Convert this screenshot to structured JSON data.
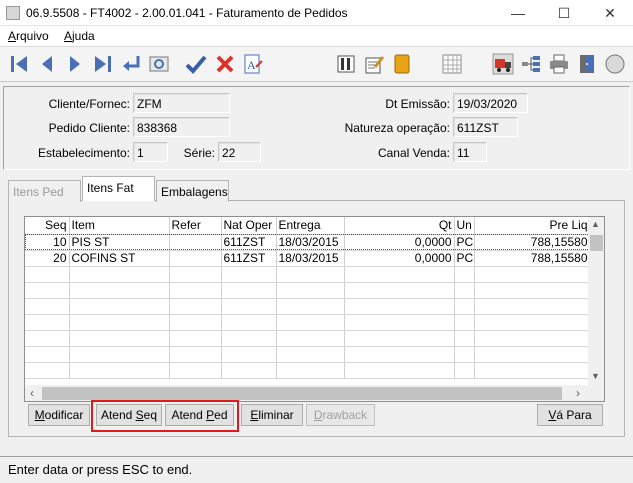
{
  "window": {
    "title": "06.9.5508 - FT4002 - 2.00.01.041 - Faturamento de Pedidos"
  },
  "menu": [
    {
      "label": "Arquivo"
    },
    {
      "label": "Ajuda"
    }
  ],
  "header": {
    "cliente_label": "Cliente/Fornec:",
    "cliente_value": "ZFM",
    "pedido_label": "Pedido Cliente:",
    "pedido_value": "838368",
    "estab_label": "Estabelecimento:",
    "estab_value": "1",
    "serie_label": "Série:",
    "serie_value": "22",
    "dt_emissao_label": "Dt Emissão:",
    "dt_emissao_value": "19/03/2020",
    "natureza_label": "Natureza operação:",
    "natureza_value": "611ZST",
    "canal_label": "Canal Venda:",
    "canal_value": "11"
  },
  "tabs": [
    {
      "label": "Itens Ped",
      "active": false,
      "disabled": true
    },
    {
      "label": "Itens Fat",
      "active": true,
      "disabled": false
    },
    {
      "label": "Embalagens",
      "active": false,
      "disabled": false
    }
  ],
  "grid": {
    "columns": [
      "Seq",
      "Item",
      "Refer",
      "Nat Oper",
      "Entrega",
      "Qt",
      "Un",
      "Pre Liq"
    ],
    "rows": [
      {
        "seq": "10",
        "item": "PIS ST",
        "refer": "",
        "nat_oper": "611ZST",
        "entrega": "18/03/2015",
        "qt": "0,0000",
        "un": "PC",
        "pre_liq": "788,15580"
      },
      {
        "seq": "20",
        "item": "COFINS ST",
        "refer": "",
        "nat_oper": "611ZST",
        "entrega": "18/03/2015",
        "qt": "0,0000",
        "un": "PC",
        "pre_liq": "788,15580"
      }
    ]
  },
  "buttons": {
    "modificar": "Modificar",
    "atend_seq": "Atend Seq",
    "atend_ped": "Atend Ped",
    "eliminar": "Eliminar",
    "drawback": "Drawback",
    "va_para": "Vá Para"
  },
  "status": {
    "text": "Enter data or press ESC to end."
  },
  "colors": {
    "highlight": "#e01b1b",
    "nav_blue": "#4a6fb5",
    "check_blue": "#3a5ea8",
    "cancel_red": "#d9342b"
  }
}
